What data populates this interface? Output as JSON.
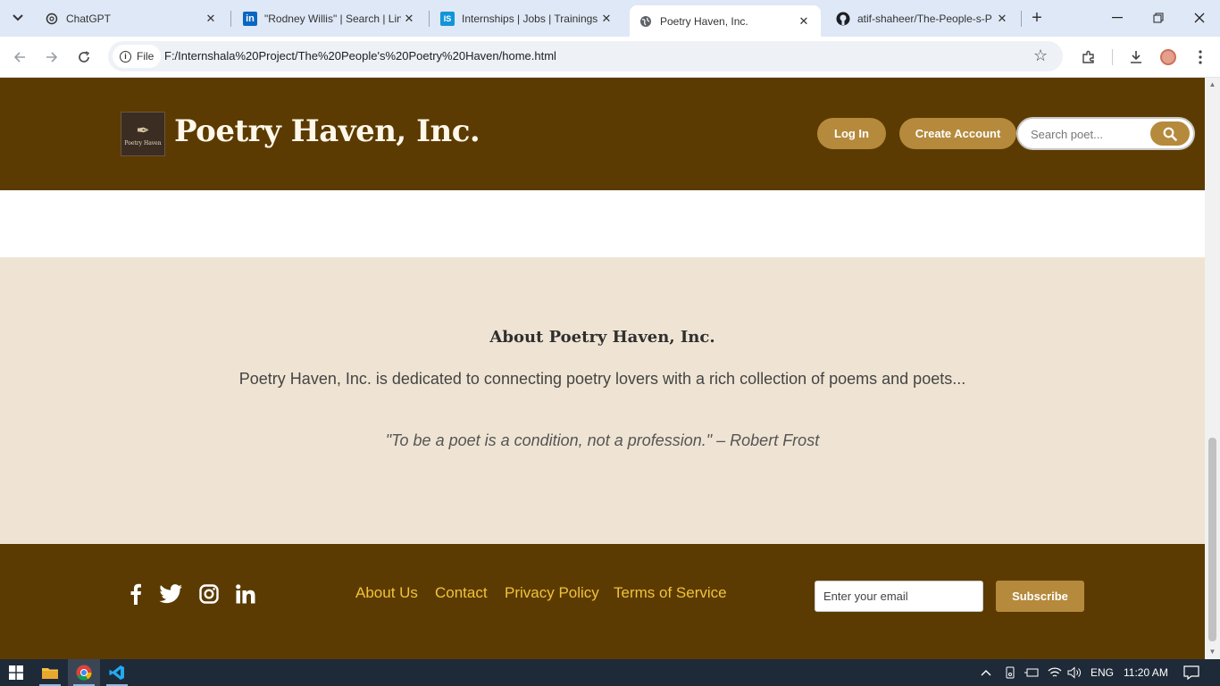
{
  "browser": {
    "tabs": [
      {
        "title": "ChatGPT",
        "favicon": "chatgpt-icon"
      },
      {
        "title": "\"Rodney Willis\" | Search | Lin",
        "favicon": "linkedin-icon"
      },
      {
        "title": "Internships | Jobs | Trainings",
        "favicon": "internshala-icon"
      },
      {
        "title": "Poetry Haven, Inc.",
        "favicon": "globe-icon",
        "active": true
      },
      {
        "title": "atif-shaheer/The-People-s-P",
        "favicon": "github-icon"
      }
    ],
    "address": {
      "chip_label": "File",
      "url": "F:/Internshala%20Project/The%20People's%20Poetry%20Haven/home.html"
    }
  },
  "site": {
    "brand": "Poetry Haven, Inc.",
    "logo_text": "Poetry Haven",
    "login_label": "Log In",
    "create_account_label": "Create Account",
    "search_placeholder": "Search poet..."
  },
  "about": {
    "title": "About Poetry Haven, Inc.",
    "text": "Poetry Haven, Inc. is dedicated to connecting poetry lovers with a rich collection of poems and poets...",
    "quote": "\"To be a poet is a condition, not a profession.\" – Robert Frost"
  },
  "footer": {
    "social": [
      "facebook-icon",
      "twitter-icon",
      "instagram-icon",
      "linkedin-icon"
    ],
    "links": [
      "About Us",
      "Contact",
      "Privacy Policy",
      "Terms of Service"
    ],
    "email_placeholder": "Enter your email",
    "subscribe_label": "Subscribe",
    "link_color": "#f0c33c",
    "bg_color": "#5c3b02"
  },
  "taskbar": {
    "language": "ENG",
    "time": "11:20 AM"
  }
}
